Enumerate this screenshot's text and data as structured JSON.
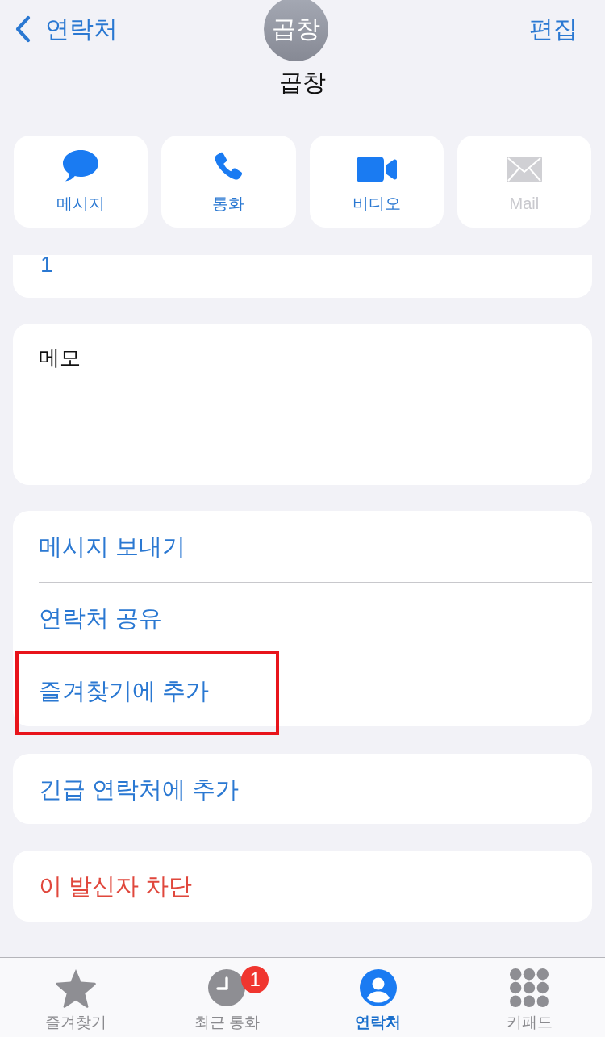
{
  "nav": {
    "back_label": "연락처",
    "edit_label": "편집"
  },
  "contact": {
    "avatar_initials": "곱창",
    "name": "곱창"
  },
  "quick_actions": [
    {
      "kind": "message",
      "label": "메시지",
      "disabled": false
    },
    {
      "kind": "call",
      "label": "통화",
      "disabled": false
    },
    {
      "kind": "video",
      "label": "비디오",
      "disabled": false
    },
    {
      "kind": "mail",
      "label": "Mail",
      "disabled": true
    }
  ],
  "phone_card": {
    "value": "1"
  },
  "notes": {
    "label": "메모"
  },
  "actions": [
    {
      "label": "메시지 보내기",
      "highlighted": false
    },
    {
      "label": "연락처 공유",
      "highlighted": false
    },
    {
      "label": "즐겨찾기에 추가",
      "highlighted": true
    }
  ],
  "emergency": {
    "label": "긴급 연락처에 추가"
  },
  "block": {
    "label": "이 발신자 차단"
  },
  "tab_bar": [
    {
      "kind": "favorites",
      "label": "즐겨찾기",
      "selected": false
    },
    {
      "kind": "recents",
      "label": "최근 통화",
      "selected": false,
      "badge": "1"
    },
    {
      "kind": "contacts",
      "label": "연락처",
      "selected": true
    },
    {
      "kind": "keypad",
      "label": "키패드",
      "selected": false
    }
  ]
}
